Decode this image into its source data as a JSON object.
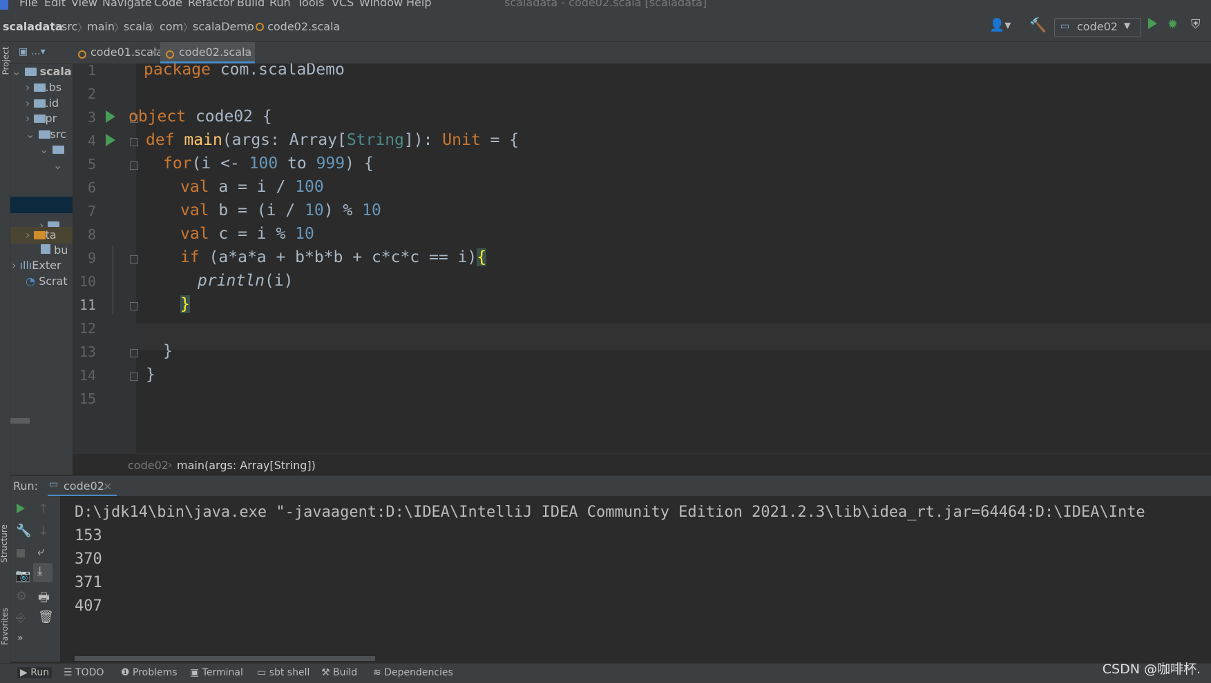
{
  "menu": [
    "File",
    "Edit",
    "View",
    "Navigate",
    "Code",
    "Refactor",
    "Build",
    "Run",
    "Tools",
    "VCS",
    "Window",
    "Help"
  ],
  "window_title": "scaladata - code02.scala [scaladata]",
  "breadcrumb": [
    "scaladata",
    "src",
    "main",
    "scala",
    "com",
    "scalaDemo",
    "code02.scala"
  ],
  "run_config": "code02",
  "project_tree": [
    {
      "label": "scala"
    },
    {
      "label": ".bs"
    },
    {
      "label": ".id"
    },
    {
      "label": "pr"
    },
    {
      "label": "src"
    },
    {
      "label": "ta"
    },
    {
      "label": "bu"
    },
    {
      "label": "Exter"
    },
    {
      "label": "Scrat"
    }
  ],
  "project_strip_label": "Project",
  "tabs": [
    {
      "label": "code01.scala",
      "active": false
    },
    {
      "label": "code02.scala",
      "active": true
    }
  ],
  "line_numbers": [
    "1",
    "2",
    "3",
    "4",
    "5",
    "6",
    "7",
    "8",
    "9",
    "10",
    "11",
    "12",
    "13",
    "14",
    "15"
  ],
  "code_tokens": {
    "l1_kw": "package",
    "l1_rest": " com.scalaDemo",
    "l3_kw": "object",
    "l3_rest": " code02 {",
    "l4_kw": "def",
    "l4_fn": "main",
    "l4_a": "(args: Array[",
    "l4_ty": "String",
    "l4_b": "]): ",
    "l4_unit": "Unit",
    "l4_c": " = {",
    "l5_kw": "for",
    "l5_a": "(i <- ",
    "l5_n1": "100",
    "l5_to": " to ",
    "l5_n2": "999",
    "l5_b": ") {",
    "l6_kw": "val",
    "l6_a": " a = i / ",
    "l6_n": "100",
    "l7_kw": "val",
    "l7_a": " b = (i / ",
    "l7_n1": "10",
    "l7_b": ") % ",
    "l7_n2": "10",
    "l8_kw": "val",
    "l8_a": " c = i % ",
    "l8_n": "10",
    "l9_kw": "if",
    "l9_a": " (a*a*a + b*b*b + c*c*c == i)",
    "l9_brace": "{",
    "l10_fn": "println",
    "l10_a": "(i)",
    "l11_brace": "}",
    "l13": "}",
    "l14": "}"
  },
  "editor_breadcrumb": {
    "first": "code02",
    "second": "main(args: Array[String])"
  },
  "run_panel": {
    "label": "Run:",
    "tab": "code02"
  },
  "console_lines": [
    "D:\\jdk14\\bin\\java.exe \"-javaagent:D:\\IDEA\\IntelliJ IDEA Community Edition 2021.2.3\\lib\\idea_rt.jar=64464:D:\\IDEA\\Inte",
    "153",
    "370",
    "371",
    "407"
  ],
  "bottom_tabs": [
    "Run",
    "TODO",
    "Problems",
    "Terminal",
    "sbt shell",
    "Build",
    "Dependencies"
  ],
  "side_labels": {
    "structure": "Structure",
    "favorites": "Favorites"
  },
  "watermark": "CSDN @咖啡杯."
}
